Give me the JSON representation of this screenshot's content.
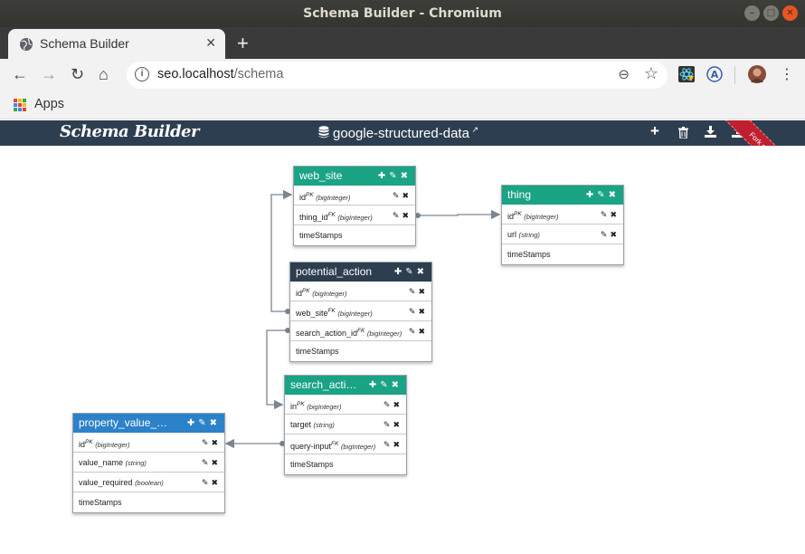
{
  "window": {
    "title": "Schema Builder - Chromium"
  },
  "tab": {
    "title": "Schema Builder",
    "close": "✕",
    "new_tab": "+"
  },
  "toolbar": {
    "url_host": "seo.localhost",
    "url_path": "/schema"
  },
  "bookmarks": {
    "apps_label": "Apps"
  },
  "app": {
    "brand": "Schema Builder",
    "database": "google-structured-data",
    "ribbon": "Fork me on GitHub"
  },
  "tables": [
    {
      "id": "web_site",
      "title": "web_site",
      "color": "#1aa384",
      "columns": [
        {
          "name": "id",
          "key": "PK",
          "type": "(bigInteger)"
        },
        {
          "name": "thing_id",
          "key": "FK",
          "type": "(bigInteger)"
        },
        {
          "name": "timeStamps",
          "key": "",
          "type": ""
        }
      ]
    },
    {
      "id": "thing",
      "title": "thing",
      "color": "#1aa384",
      "columns": [
        {
          "name": "id",
          "key": "PK",
          "type": "(bigInteger)"
        },
        {
          "name": "url",
          "key": "",
          "type": "(string)"
        },
        {
          "name": "timeStamps",
          "key": "",
          "type": ""
        }
      ]
    },
    {
      "id": "potential_action",
      "title": "potential_action",
      "color": "#2d3e50",
      "columns": [
        {
          "name": "id",
          "key": "PK",
          "type": "(bigInteger)"
        },
        {
          "name": "web_site",
          "key": "FK",
          "type": "(bigInteger)"
        },
        {
          "name": "search_action_id",
          "key": "FK",
          "type": "(bigInteger)"
        },
        {
          "name": "timeStamps",
          "key": "",
          "type": ""
        }
      ]
    },
    {
      "id": "search_action",
      "title": "search_acti…",
      "color": "#1aa384",
      "columns": [
        {
          "name": "in",
          "key": "PK",
          "type": "(bigInteger)"
        },
        {
          "name": "target",
          "key": "",
          "type": "(string)"
        },
        {
          "name": "query-input",
          "key": "FK",
          "type": "(bigInteger)"
        },
        {
          "name": "timeStamps",
          "key": "",
          "type": ""
        }
      ]
    },
    {
      "id": "property_value",
      "title": "property_value_…",
      "color": "#2c82c9",
      "columns": [
        {
          "name": "id",
          "key": "PK",
          "type": "(bigInteger)"
        },
        {
          "name": "value_name",
          "key": "",
          "type": "(string)"
        },
        {
          "name": "value_required",
          "key": "",
          "type": "(boolean)"
        },
        {
          "name": "timeStamps",
          "key": "",
          "type": ""
        }
      ]
    }
  ]
}
